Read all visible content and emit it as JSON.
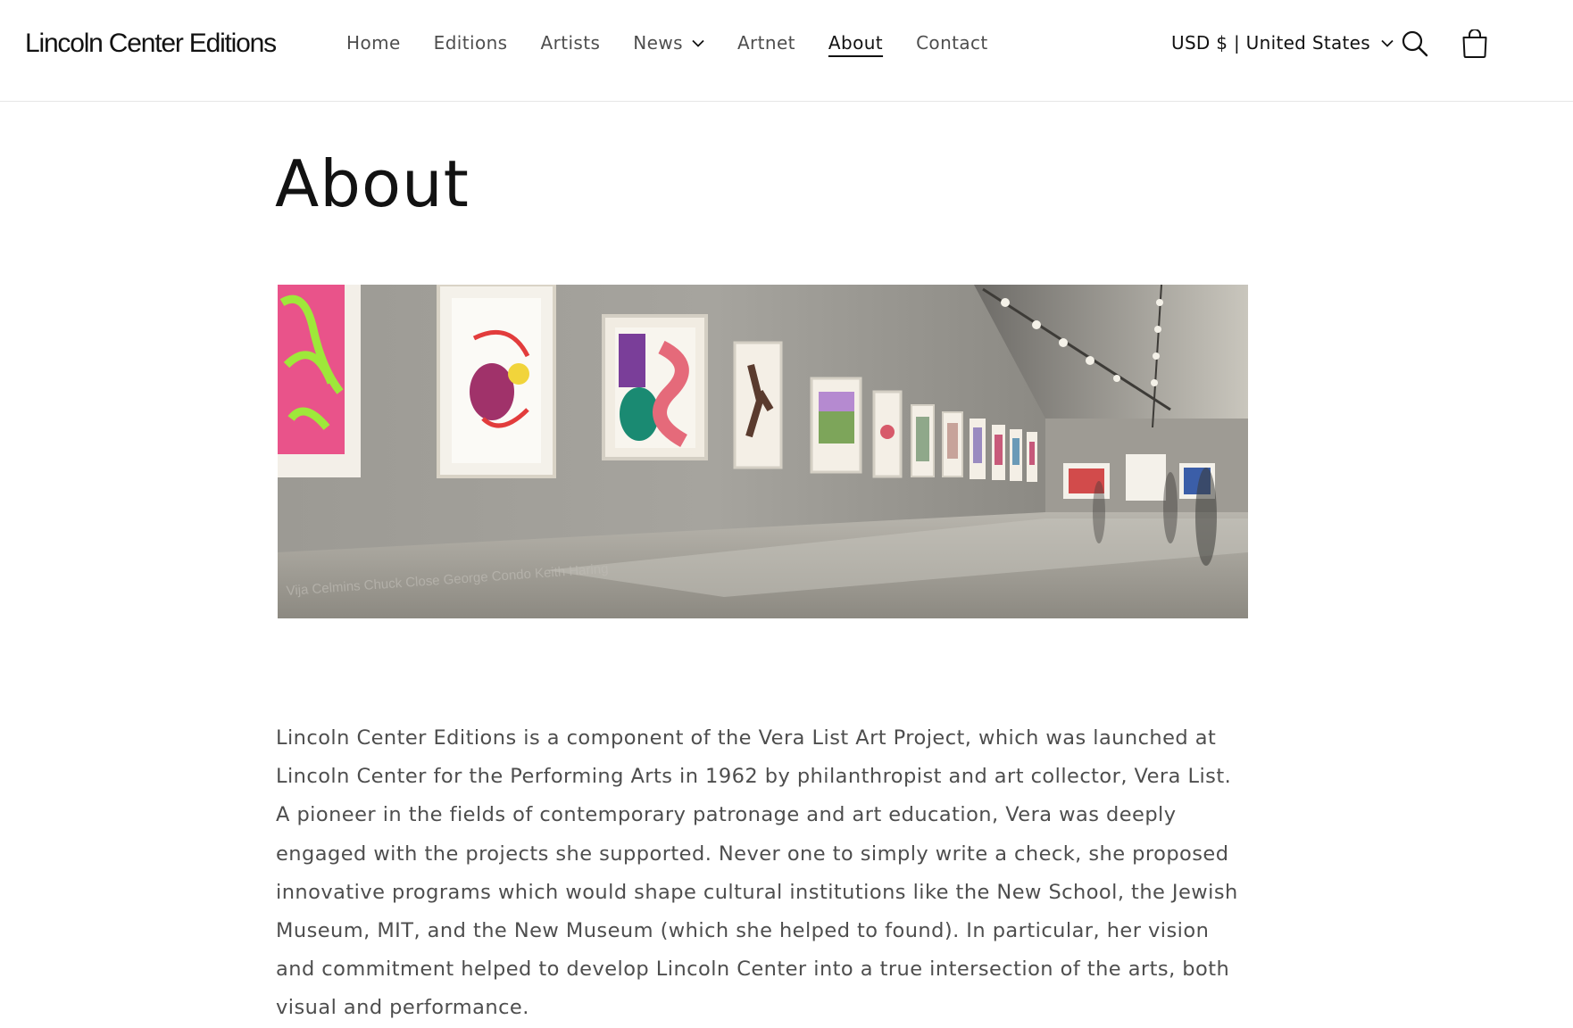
{
  "header": {
    "logo": "Lincoln Center Editions",
    "nav": [
      {
        "label": "Home"
      },
      {
        "label": "Editions"
      },
      {
        "label": "Artists"
      },
      {
        "label": "News"
      },
      {
        "label": "Artnet"
      },
      {
        "label": "About"
      },
      {
        "label": "Contact"
      }
    ],
    "country_selector": "USD $ | United States",
    "icons": {
      "search": "search-icon",
      "cart": "cart-icon",
      "dropdown": "chevron-down-icon"
    }
  },
  "main": {
    "title": "About",
    "hero_image": {
      "caption_overlay": "Vija Celmins  Chuck Close  George Condo  Keith Haring"
    },
    "paragraph": "Lincoln Center Editions is a component of the Vera List Art Project, which was launched at Lincoln Center for the Performing Arts in 1962 by philanthropist and art collector, Vera List. A pioneer in the fields of contemporary patronage and art education, Vera was deeply engaged with the projects she supported. Never one to simply write a check, she proposed innovative programs which would shape cultural institutions like the New School, the Jewish Museum, MIT, and the New Museum (which she helped to found). In particular, her vision and commitment helped to develop Lincoln Center into a true intersection of the arts, both visual and performance."
  },
  "colors": {
    "text": "#121212",
    "muted_text": "#5a5a5a",
    "border": "#e6e6e6"
  }
}
